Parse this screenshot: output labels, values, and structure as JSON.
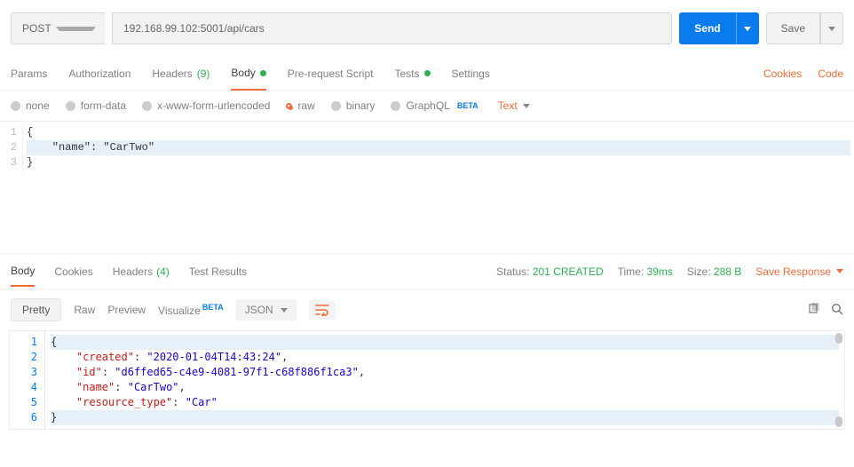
{
  "request": {
    "method": "POST",
    "url": "192.168.99.102:5001/api/cars",
    "send_label": "Send",
    "save_label": "Save"
  },
  "tabs": {
    "params": "Params",
    "authorization": "Authorization",
    "headers": "Headers",
    "headers_count": "(9)",
    "body": "Body",
    "prerequest": "Pre-request Script",
    "tests": "Tests",
    "settings": "Settings",
    "cookies_link": "Cookies",
    "code_link": "Code"
  },
  "body_types": {
    "none": "none",
    "formdata": "form-data",
    "urlencoded": "x-www-form-urlencoded",
    "raw": "raw",
    "binary": "binary",
    "graphql": "GraphQL",
    "graphql_beta": "BETA",
    "text_dd": "Text"
  },
  "request_body": {
    "lines": [
      "{",
      "    \"name\": \"CarTwo\"",
      "}"
    ]
  },
  "response_tabs": {
    "body": "Body",
    "cookies": "Cookies",
    "headers": "Headers",
    "headers_count": "(4)",
    "test_results": "Test Results"
  },
  "response_meta": {
    "status_label": "Status:",
    "status_value": "201 CREATED",
    "time_label": "Time:",
    "time_value": "39ms",
    "size_label": "Size:",
    "size_value": "288 B",
    "save_response": "Save Response"
  },
  "response_toolbar": {
    "pretty": "Pretty",
    "raw": "Raw",
    "preview": "Preview",
    "visualize": "Visualize",
    "visualize_beta": "BETA",
    "format": "JSON"
  },
  "response_body": {
    "created_key": "\"created\"",
    "created_val": "\"2020-01-04T14:43:24\"",
    "id_key": "\"id\"",
    "id_val": "\"d6ffed65-c4e9-4081-97f1-c68f886f1ca3\"",
    "name_key": "\"name\"",
    "name_val": "\"CarTwo\"",
    "rt_key": "\"resource_type\"",
    "rt_val": "\"Car\""
  }
}
